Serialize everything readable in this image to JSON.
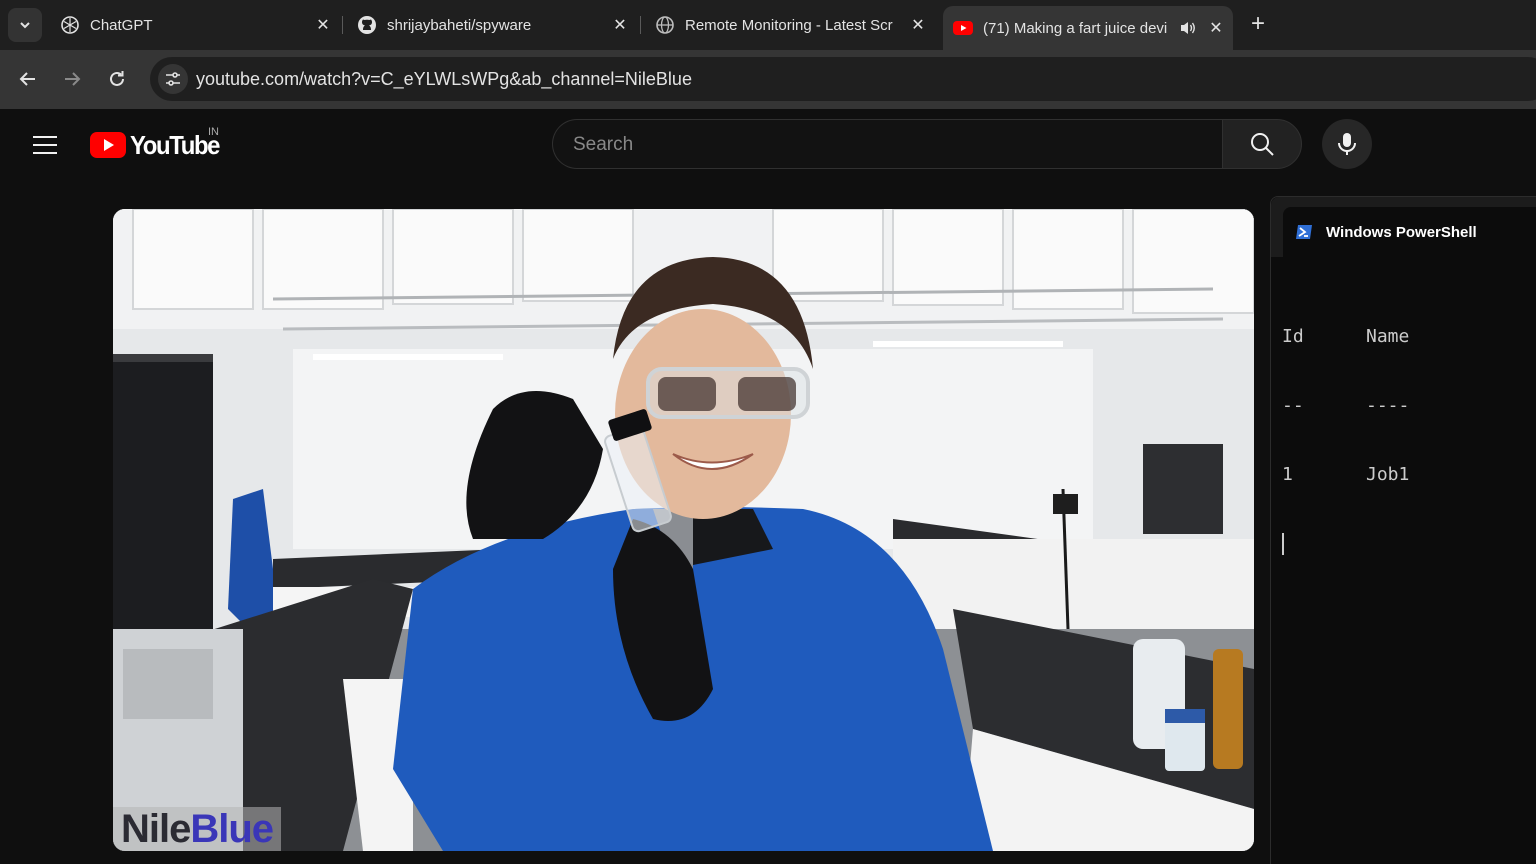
{
  "browser": {
    "tabs": [
      {
        "title": "ChatGPT",
        "icon": "chatgpt-icon",
        "active": false
      },
      {
        "title": "shrijaybaheti/spyware",
        "icon": "github-icon",
        "active": false
      },
      {
        "title": "Remote Monitoring - Latest Scr",
        "icon": "globe-icon",
        "active": false
      },
      {
        "title": "(71) Making a fart juice devi",
        "icon": "youtube-icon",
        "active": true,
        "audio": true
      }
    ],
    "url": "youtube.com/watch?v=C_eYLWLsWPg&ab_channel=NileBlue"
  },
  "youtube": {
    "logo_text": "YouTube",
    "country_code": "IN",
    "search": {
      "placeholder": "Search",
      "value": ""
    }
  },
  "video": {
    "watermark_part1": "Nile",
    "watermark_part2": "Blue"
  },
  "powershell": {
    "window_title": "Windows PowerShell",
    "table": {
      "headers": [
        "Id",
        "Name"
      ],
      "underlines": [
        "--",
        "----"
      ],
      "rows": [
        [
          "1",
          "Job1"
        ]
      ]
    }
  },
  "colors": {
    "youtube_red": "#ff0000",
    "powershell_blue": "#2f6fd6",
    "watermark_blue": "#3a36b8"
  }
}
